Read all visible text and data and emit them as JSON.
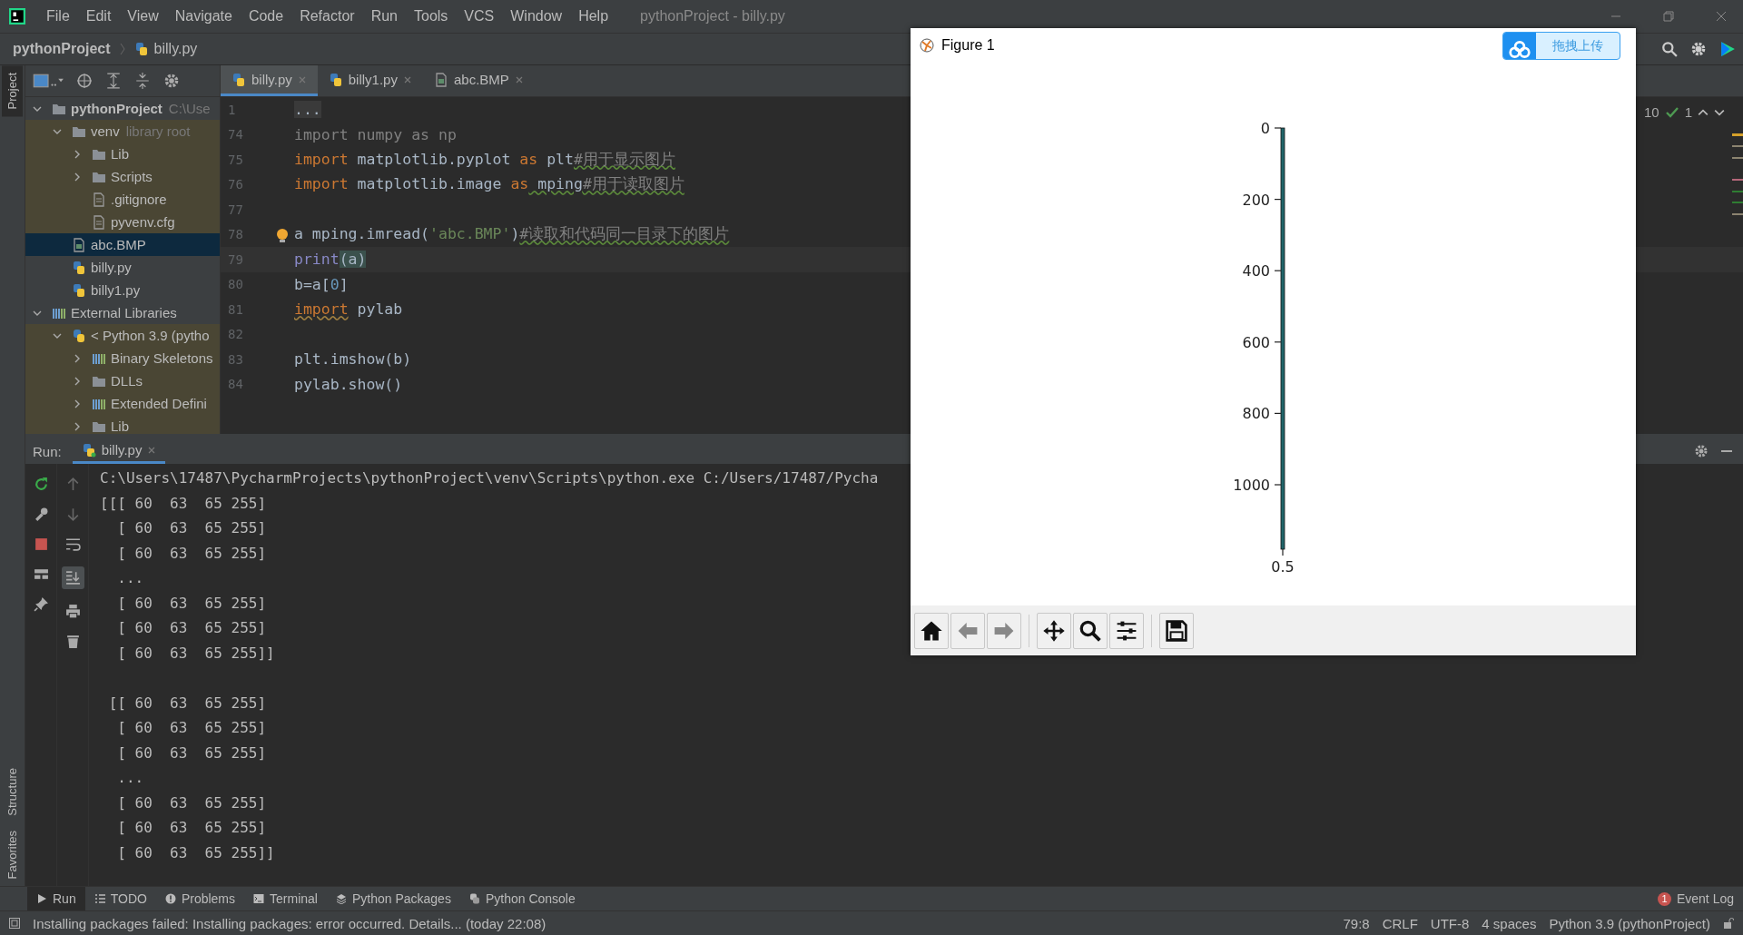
{
  "menu": {
    "items": [
      "File",
      "Edit",
      "View",
      "Navigate",
      "Code",
      "Refactor",
      "Run",
      "Tools",
      "VCS",
      "Window",
      "Help"
    ],
    "title": "pythonProject - billy.py"
  },
  "breadcrumb": [
    "pythonProject",
    "billy.py"
  ],
  "side_strip": {
    "top": [
      {
        "label": "Project",
        "selected": true
      }
    ],
    "bottom": [
      {
        "label": "Structure",
        "selected": false
      },
      {
        "label": "Favorites",
        "selected": false
      }
    ]
  },
  "project_tree": [
    {
      "label": "pythonProject",
      "hint": "C:\\Use",
      "kind": "folder",
      "expanded": true,
      "selected": false,
      "tinted": false,
      "children": [
        {
          "label": "venv",
          "hint": "library root",
          "kind": "folder",
          "expanded": true,
          "selected": false,
          "tinted": true,
          "children": [
            {
              "label": "Lib",
              "kind": "folder",
              "expanded": false,
              "selected": false,
              "tinted": true
            },
            {
              "label": "Scripts",
              "kind": "folder",
              "expanded": false,
              "selected": false,
              "tinted": true
            },
            {
              "label": ".gitignore",
              "kind": "file",
              "selected": false,
              "tinted": true
            },
            {
              "label": "pyvenv.cfg",
              "kind": "file",
              "selected": false,
              "tinted": true
            }
          ]
        },
        {
          "label": "abc.BMP",
          "kind": "image",
          "selected": true,
          "tinted": false
        },
        {
          "label": "billy.py",
          "kind": "python",
          "selected": false,
          "tinted": false
        },
        {
          "label": "billy1.py",
          "kind": "python",
          "selected": false,
          "tinted": false
        }
      ]
    },
    {
      "label": "External Libraries",
      "kind": "library",
      "expanded": true,
      "selected": false,
      "tinted": false,
      "children": [
        {
          "label": "< Python 3.9 (pytho",
          "kind": "interpreter",
          "expanded": true,
          "selected": false,
          "tinted": true,
          "children": [
            {
              "label": "Binary Skeletons",
              "kind": "library",
              "expanded": false,
              "selected": false,
              "tinted": true
            },
            {
              "label": "DLLs",
              "kind": "folder",
              "expanded": false,
              "selected": false,
              "tinted": true
            },
            {
              "label": "Extended Defini",
              "kind": "library",
              "expanded": false,
              "selected": false,
              "tinted": true
            },
            {
              "label": "Lib",
              "kind": "folder",
              "expanded": false,
              "selected": false,
              "tinted": true
            }
          ]
        }
      ]
    }
  ],
  "editor_tabs": [
    {
      "label": "billy.py",
      "kind": "python",
      "selected": true
    },
    {
      "label": "billy1.py",
      "kind": "python",
      "selected": false
    },
    {
      "label": "abc.BMP",
      "kind": "image",
      "selected": false
    }
  ],
  "editor_lines": [
    {
      "number": "1",
      "current": false,
      "bulb": false,
      "tokens": [
        {
          "kind": "fold",
          "t": "..."
        }
      ]
    },
    {
      "number": "74",
      "current": false,
      "bulb": false,
      "tokens": [
        {
          "kind": "gray",
          "t": "import numpy as np"
        }
      ]
    },
    {
      "number": "75",
      "current": false,
      "bulb": false,
      "tokens": [
        {
          "kind": "kw",
          "t": "import"
        },
        {
          "kind": "plain",
          "t": " matplotlib.pyplot "
        },
        {
          "kind": "kw",
          "t": "as"
        },
        {
          "kind": "plain",
          "t": " plt"
        },
        {
          "kind": "cmt",
          "t": "#用于显示图片"
        }
      ]
    },
    {
      "number": "76",
      "current": false,
      "bulb": false,
      "tokens": [
        {
          "kind": "kw",
          "t": "import"
        },
        {
          "kind": "plain",
          "t": " matplotlib.image "
        },
        {
          "kind": "kw",
          "t": "as"
        },
        {
          "kind": "warn",
          "t": " mping"
        },
        {
          "kind": "cmt",
          "t": "#用于读取图片"
        }
      ]
    },
    {
      "number": "77",
      "current": false,
      "bulb": false
    },
    {
      "number": "78",
      "current": false,
      "bulb": true,
      "tokens": [
        {
          "kind": "plain",
          "t": "a mping.imread("
        },
        {
          "kind": "str",
          "t": "'abc.BMP'"
        },
        {
          "kind": "plain",
          "t": ")"
        },
        {
          "kind": "cmt",
          "t": "#读取和代码同一目录下的图片"
        }
      ]
    },
    {
      "number": "79",
      "current": true,
      "bulb": false,
      "tokens": [
        {
          "kind": "fn",
          "t": "print"
        },
        {
          "kind": "paren",
          "t": "(a)"
        }
      ]
    },
    {
      "number": "80",
      "current": false,
      "bulb": false,
      "tokens": [
        {
          "kind": "plain",
          "t": "b=a["
        },
        {
          "kind": "num",
          "t": "0"
        },
        {
          "kind": "plain",
          "t": "]"
        }
      ]
    },
    {
      "number": "81",
      "current": false,
      "bulb": false,
      "tokens": [
        {
          "kind": "kwwarn",
          "t": "import"
        },
        {
          "kind": "plain",
          "t": " pylab"
        }
      ]
    },
    {
      "number": "82",
      "current": false,
      "bulb": false
    },
    {
      "number": "83",
      "current": false,
      "bulb": false,
      "tokens": [
        {
          "kind": "plain",
          "t": "plt.imshow(b)"
        }
      ]
    },
    {
      "number": "84",
      "current": false,
      "bulb": false,
      "tokens": [
        {
          "kind": "plain",
          "t": "pylab.show()"
        }
      ]
    }
  ],
  "inspections": {
    "warnings": "10",
    "weak_warnings": "1"
  },
  "run": {
    "label": "Run:",
    "tab": "billy.py",
    "output": [
      [
        "C:\\Users\\17487\\PycharmProjects\\pythonProject\\venv\\Scripts\\python.exe C:/Users/17487/Pycha",
        "[[[ 60  63  65 255]",
        "  [ 60  63  65 255]",
        "  [ 60  63  65 255]",
        "  ...",
        "  [ 60  63  65 255]",
        "  [ 60  63  65 255]",
        "  [ 60  63  65 255]]"
      ],
      [
        " [[ 60  63  65 255]",
        "  [ 60  63  65 255]",
        "  [ 60  63  65 255]",
        "  ...",
        "  [ 60  63  65 255]",
        "  [ 60  63  65 255]",
        "  [ 60  63  65 255]]"
      ]
    ]
  },
  "bottom_tabs": [
    {
      "label": "Run",
      "kind": "run",
      "selected": true
    },
    {
      "label": "TODO",
      "kind": "list",
      "selected": false
    },
    {
      "label": "Problems",
      "kind": "info",
      "selected": false
    },
    {
      "label": "Terminal",
      "kind": "terminal",
      "selected": false
    },
    {
      "label": "Python Packages",
      "kind": "layers",
      "selected": false
    },
    {
      "label": "Python Console",
      "kind": "python",
      "selected": false
    }
  ],
  "event_log": {
    "label": "Event Log",
    "count": "1"
  },
  "status": {
    "message": "Installing packages failed: Installing packages: error occurred. Details... (today 22:08)",
    "items": [
      "79:8",
      "CRLF",
      "UTF-8",
      "4 spaces",
      "Python 3.9 (pythonProject)"
    ]
  },
  "figure": {
    "title": "Figure 1",
    "y_ticks": [
      "0",
      "200",
      "400",
      "600",
      "800",
      "1000"
    ],
    "x_tick": "0.5"
  },
  "upload_button": "拖拽上传"
}
